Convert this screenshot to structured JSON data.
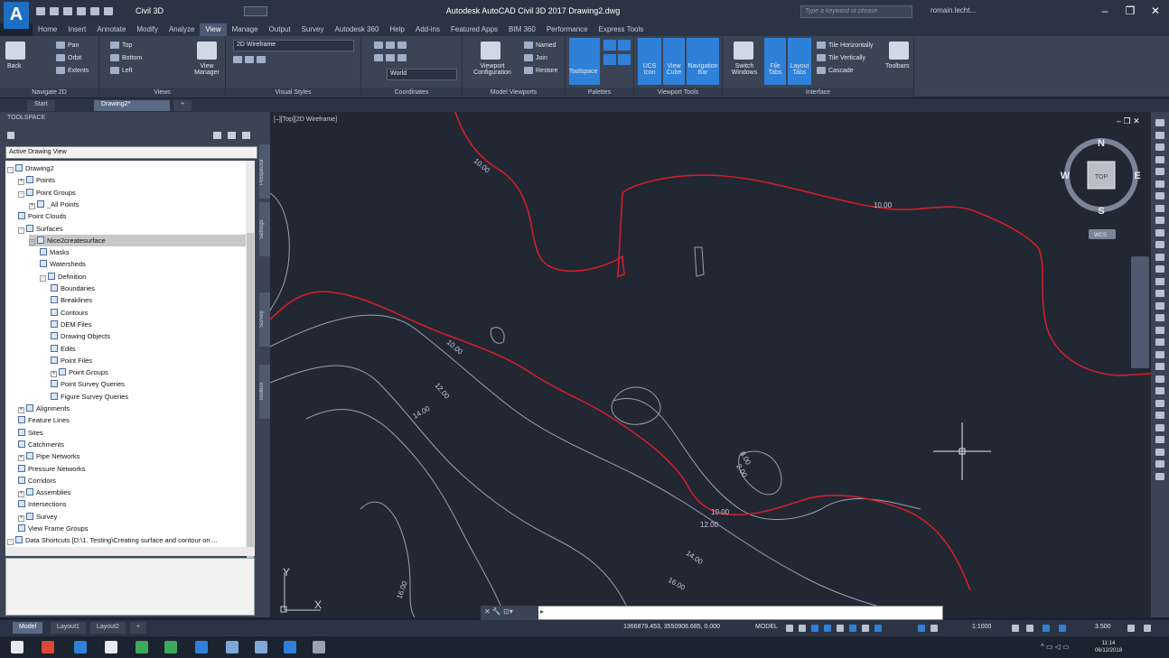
{
  "window": {
    "title": "Autodesk AutoCAD Civil 3D 2017   Drawing2.dwg",
    "workspace": "Civil 3D",
    "search_placeholder": "Type a keyword or phrase",
    "user": "romain.lecht...",
    "controls": {
      "minimize": "–",
      "restore": "❐",
      "close": "✕"
    }
  },
  "ribbon_tabs": [
    "Home",
    "Insert",
    "Annotate",
    "Modify",
    "Analyze",
    "View",
    "Manage",
    "Output",
    "Survey",
    "Autodesk 360",
    "Help",
    "Add-ins",
    "Featured Apps",
    "BIM 360",
    "Performance",
    "Express Tools"
  ],
  "ribbon_active_tab": "View",
  "ribbon": {
    "navigate": {
      "label": "Navigate 2D",
      "back": "Back",
      "pan": "Pan",
      "orbit": "Orbit",
      "extents": "Extents"
    },
    "views": {
      "label": "Views",
      "top": "Top",
      "bottom": "Bottom",
      "left": "Left",
      "manager": "View Manager"
    },
    "visual_styles": {
      "label": "Visual Styles",
      "current": "2D Wireframe"
    },
    "coordinates": {
      "label": "Coordinates",
      "current": "World"
    },
    "model_viewports": {
      "label": "Model Viewports",
      "config": "Viewport Configuration",
      "named": "Named",
      "join": "Join",
      "restore": "Restore"
    },
    "palettes": {
      "label": "Palettes",
      "toolspace": "Toolspace"
    },
    "viewport_tools": {
      "label": "Viewport Tools",
      "ucs": "UCS Icon",
      "viewcube": "View Cube",
      "navbar": "Navigation Bar"
    },
    "interface": {
      "label": "Interface",
      "switch": "Switch Windows",
      "file_tabs": "File Tabs",
      "layout_tabs": "Layout Tabs",
      "tile_h": "Tile Horizontally",
      "tile_v": "Tile Vertically",
      "cascade": "Cascade",
      "toolbars": "Toolbars"
    }
  },
  "file_tabs": [
    "Start",
    "Drawing2*"
  ],
  "toolspace": {
    "title": "TOOLSPACE",
    "view_select": "Active Drawing View",
    "tree": [
      {
        "label": "Drawing2",
        "level": 0,
        "exp": "-"
      },
      {
        "label": "Points",
        "level": 1,
        "exp": "+"
      },
      {
        "label": "Point Groups",
        "level": 1,
        "exp": "-"
      },
      {
        "label": "_All Points",
        "level": 2,
        "exp": "+"
      },
      {
        "label": "Point Clouds",
        "level": 1,
        "exp": ""
      },
      {
        "label": "Surfaces",
        "level": 1,
        "exp": "-"
      },
      {
        "label": "Nice2createsurface",
        "level": 2,
        "exp": "-",
        "selected": true
      },
      {
        "label": "Masks",
        "level": 3,
        "exp": ""
      },
      {
        "label": "Watersheds",
        "level": 3,
        "exp": ""
      },
      {
        "label": "Definition",
        "level": 3,
        "exp": "-"
      },
      {
        "label": "Boundaries",
        "level": 4,
        "exp": ""
      },
      {
        "label": "Breaklines",
        "level": 4,
        "exp": ""
      },
      {
        "label": "Contours",
        "level": 4,
        "exp": ""
      },
      {
        "label": "DEM Files",
        "level": 4,
        "exp": ""
      },
      {
        "label": "Drawing Objects",
        "level": 4,
        "exp": ""
      },
      {
        "label": "Edits",
        "level": 4,
        "exp": ""
      },
      {
        "label": "Point Files",
        "level": 4,
        "exp": ""
      },
      {
        "label": "Point Groups",
        "level": 4,
        "exp": "+"
      },
      {
        "label": "Point Survey Queries",
        "level": 4,
        "exp": ""
      },
      {
        "label": "Figure Survey Queries",
        "level": 4,
        "exp": ""
      },
      {
        "label": "Alignments",
        "level": 1,
        "exp": "+"
      },
      {
        "label": "Feature Lines",
        "level": 1,
        "exp": ""
      },
      {
        "label": "Sites",
        "level": 1,
        "exp": ""
      },
      {
        "label": "Catchments",
        "level": 1,
        "exp": ""
      },
      {
        "label": "Pipe Networks",
        "level": 1,
        "exp": "+"
      },
      {
        "label": "Pressure Networks",
        "level": 1,
        "exp": ""
      },
      {
        "label": "Corridors",
        "level": 1,
        "exp": ""
      },
      {
        "label": "Assemblies",
        "level": 1,
        "exp": "+"
      },
      {
        "label": "Intersections",
        "level": 1,
        "exp": ""
      },
      {
        "label": "Survey",
        "level": 1,
        "exp": "+"
      },
      {
        "label": "View Frame Groups",
        "level": 1,
        "exp": ""
      },
      {
        "label": "Data Shortcuts [D:\\1. Testing\\Creating surface and contour on ...",
        "level": 0,
        "exp": "-"
      }
    ]
  },
  "side_tabs": [
    "Prospector",
    "Settings",
    "Survey",
    "Toolbox"
  ],
  "viewport": {
    "label": "[–][Top][2D Wireframe]",
    "controls": "– ❐ ✕",
    "viewcube": {
      "face": "TOP",
      "n": "N",
      "s": "S",
      "e": "E",
      "w": "W",
      "wcs": "WCS"
    },
    "ucs_x": "X",
    "ucs_y": "Y",
    "contour_labels": [
      "10.00",
      "10.00",
      "10.00",
      "10.00",
      "12.00",
      "14.00",
      "12.00",
      "14.00",
      "16.00",
      "16.00",
      "8.00",
      "2.00"
    ]
  },
  "command_line": {
    "prompt": "▸",
    "buttons": "✕ 🔧 ⊡▾"
  },
  "layout_tabs": [
    "Model",
    "Layout1",
    "Layout2",
    "+"
  ],
  "status_bar": {
    "coords": "1366879.453, 3550906.685, 0.000",
    "model": "MODEL",
    "scale": "1:1000",
    "annoscale": "3.500"
  },
  "taskbar": {
    "time": "11:14",
    "date": "06/12/2018"
  },
  "colors": {
    "accent": "#2f80d8",
    "contour_major": "#d0202a",
    "contour_minor": "#9aa2b0",
    "canvas": "#222734"
  }
}
